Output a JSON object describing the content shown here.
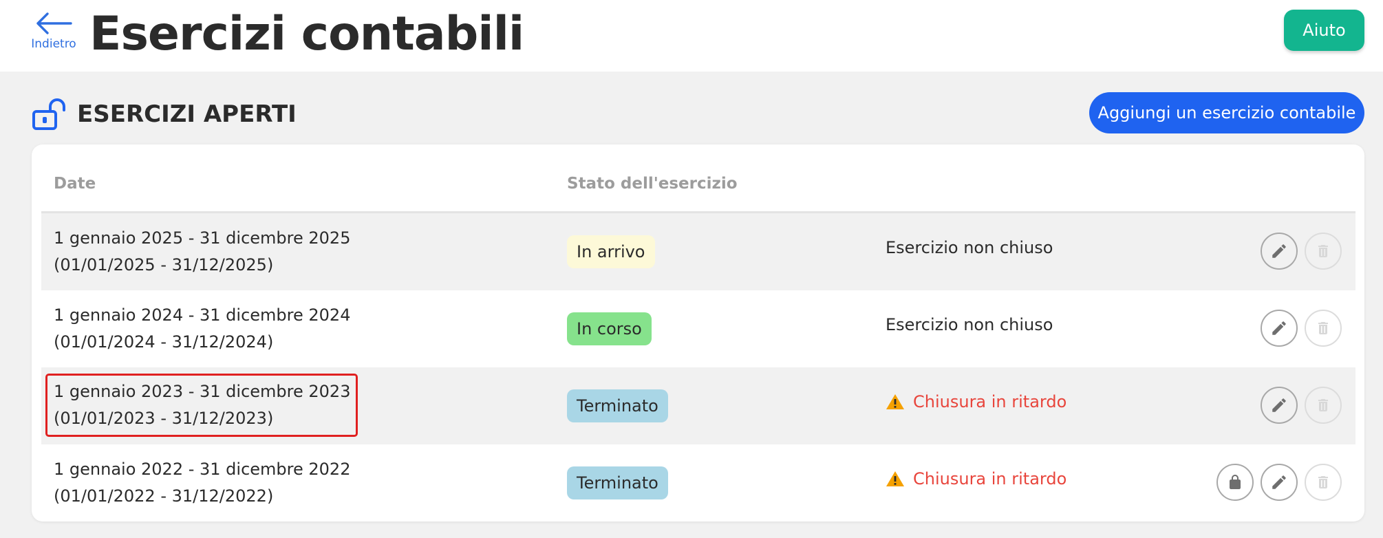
{
  "header": {
    "back_label": "Indietro",
    "title": "Esercizi contabili",
    "help_label": "Aiuto"
  },
  "section": {
    "title": "ESERCIZI APERTI",
    "add_button_label": "Aggiungi un esercizio contabile"
  },
  "table": {
    "columns": [
      "Date",
      "Stato dell'esercizio"
    ],
    "rows": [
      {
        "date_line1": "1 gennaio 2025 - 31 dicembre 2025",
        "date_line2": "(01/01/2025 - 31/12/2025)",
        "status_badge": "In arrivo",
        "closure_status": "Esercizio non chiuso",
        "actions": [
          "edit",
          "delete-disabled"
        ]
      },
      {
        "date_line1": "1 gennaio 2024 - 31 dicembre 2024",
        "date_line2": "(01/01/2024 - 31/12/2024)",
        "status_badge": "In corso",
        "closure_status": "Esercizio non chiuso",
        "actions": [
          "edit",
          "delete-disabled"
        ]
      },
      {
        "date_line1": "1 gennaio 2023 - 31 dicembre 2023",
        "date_line2": "(01/01/2023 - 31/12/2023)",
        "status_badge": "Terminato",
        "closure_status": "Chiusura in ritardo",
        "actions": [
          "edit",
          "delete-disabled"
        ]
      },
      {
        "date_line1": "1 gennaio 2022 - 31 dicembre 2022",
        "date_line2": "(01/01/2022 - 31/12/2022)",
        "status_badge": "Terminato",
        "closure_status": "Chiusura in ritardo",
        "actions": [
          "lock",
          "edit",
          "delete-disabled"
        ]
      }
    ]
  },
  "colors": {
    "accent_blue": "#1f63f0",
    "help_green": "#13b58f",
    "badge_upcoming": "#fdf9d8",
    "badge_in_progress": "#86e28c",
    "badge_finished": "#a9d6e6",
    "late_red": "#e8453c",
    "warning_orange": "#f5a100",
    "highlight_red": "#e02020"
  },
  "icons": [
    "arrow-left-icon",
    "unlock-icon",
    "pencil-icon",
    "trash-icon",
    "lock-icon",
    "warning-icon"
  ]
}
